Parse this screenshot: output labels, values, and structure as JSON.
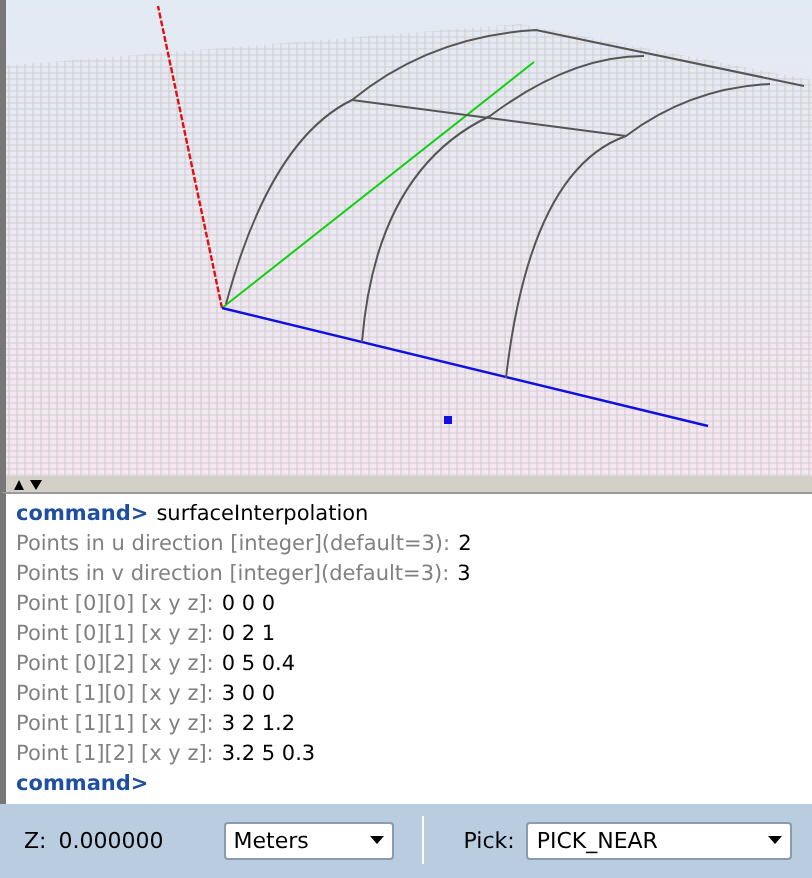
{
  "console": {
    "lines": [
      {
        "kind": "prompt",
        "label": "command>",
        "value": "surfaceInterpolation"
      },
      {
        "kind": "question",
        "label": "Points in u direction [integer](default=3):",
        "value": "2"
      },
      {
        "kind": "question",
        "label": "Points in v direction [integer](default=3):",
        "value": "3"
      },
      {
        "kind": "question",
        "label": "Point [0][0] [x y z]:",
        "value": "0 0 0"
      },
      {
        "kind": "question",
        "label": "Point [0][1] [x y z]:",
        "value": "0 2 1"
      },
      {
        "kind": "question",
        "label": "Point [0][2] [x y z]:",
        "value": "0 5 0.4"
      },
      {
        "kind": "question",
        "label": "Point [1][0] [x y z]:",
        "value": "3 0 0"
      },
      {
        "kind": "question",
        "label": "Point [1][1] [x y z]:",
        "value": "3 2 1.2"
      },
      {
        "kind": "question",
        "label": "Point [1][2] [x y z]:",
        "value": "3.2 5 0.3"
      },
      {
        "kind": "prompt",
        "label": "command>"
      }
    ]
  },
  "status_bar": {
    "z_label": "Z:",
    "z_value": "0.000000",
    "units": "Meters",
    "pick_label": "Pick:",
    "pick": "PICK_NEAR"
  }
}
